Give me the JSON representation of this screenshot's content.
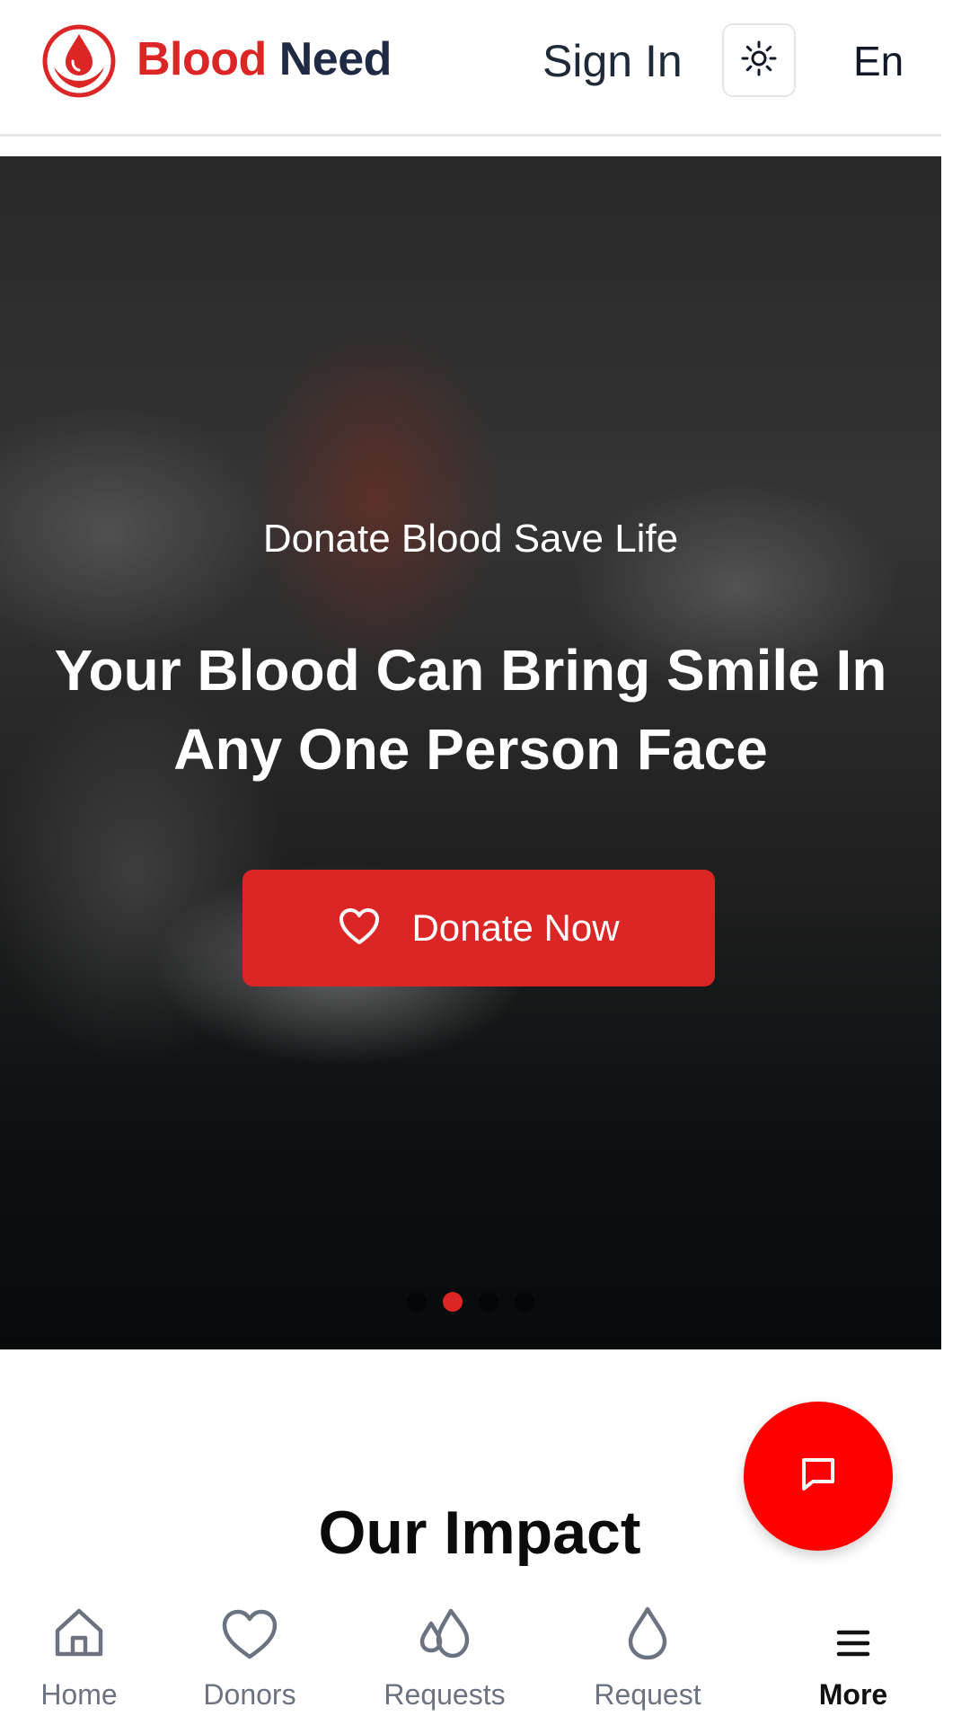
{
  "header": {
    "brand_part1": "Blood",
    "brand_part2": "Need",
    "signin_label": "Sign In",
    "theme_icon": "sun-icon",
    "language_label": "En"
  },
  "hero": {
    "subtitle": "Donate Blood Save Life",
    "title": "Your Blood Can Bring Smile In Any One Person Face",
    "cta_label": "Donate Now",
    "cta_icon": "heart-icon",
    "slides_count": 4,
    "active_slide": 2
  },
  "impact": {
    "title": "Our Impact"
  },
  "chat": {
    "icon": "chat-icon"
  },
  "bottom_nav": {
    "items": [
      {
        "label": "Home",
        "icon": "home-icon"
      },
      {
        "label": "Donors",
        "icon": "heart-icon"
      },
      {
        "label": "Requests",
        "icon": "drops-icon"
      },
      {
        "label": "Request",
        "icon": "drop-icon"
      },
      {
        "label": "More",
        "icon": "menu-icon"
      }
    ],
    "active": "More"
  },
  "colors": {
    "brand_red": "#dc2626",
    "brand_dark": "#1f2a44",
    "fab_red": "#ff0000",
    "nav_inactive": "#6b7280"
  }
}
